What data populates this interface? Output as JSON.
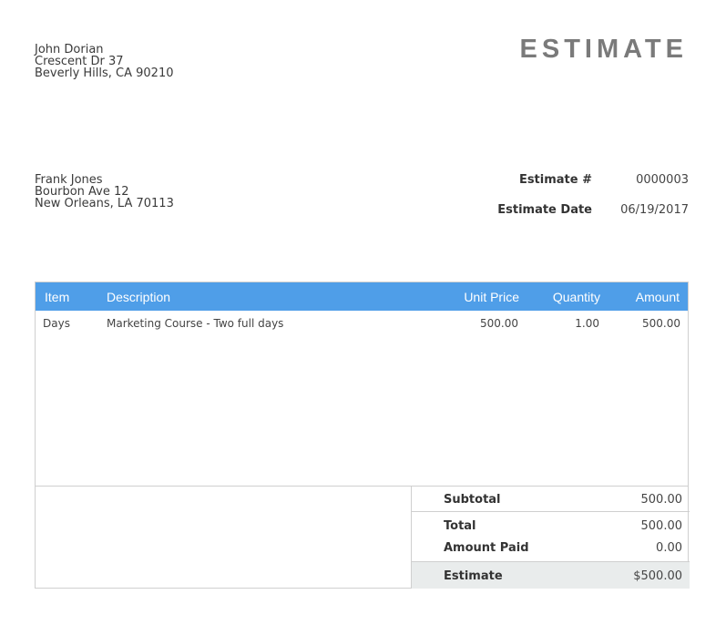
{
  "sender": {
    "name": "John Dorian",
    "street": "Crescent Dr 37",
    "city": "Beverly Hills, CA 90210"
  },
  "document": {
    "title": "ESTIMATE"
  },
  "recipient": {
    "name": "Frank Jones",
    "street": "Bourbon Ave 12",
    "city": "New Orleans, LA 70113"
  },
  "meta": {
    "number_label": "Estimate #",
    "number_value": "0000003",
    "date_label": "Estimate Date",
    "date_value": "06/19/2017"
  },
  "table": {
    "headers": {
      "item": "Item",
      "description": "Description",
      "unit_price": "Unit Price",
      "quantity": "Quantity",
      "amount": "Amount"
    },
    "rows": [
      {
        "item": "Days",
        "description": "Marketing Course - Two full days",
        "unit_price": "500.00",
        "quantity": "1.00",
        "amount": "500.00"
      }
    ]
  },
  "totals": {
    "subtotal_label": "Subtotal",
    "subtotal_value": "500.00",
    "total_label": "Total",
    "total_value": "500.00",
    "paid_label": "Amount Paid",
    "paid_value": "0.00",
    "estimate_label": "Estimate",
    "estimate_value": "$500.00"
  },
  "colors": {
    "header_bg": "#4f9ee8",
    "title": "#7a7a7a",
    "grand_total_bg": "#e9ecec"
  }
}
